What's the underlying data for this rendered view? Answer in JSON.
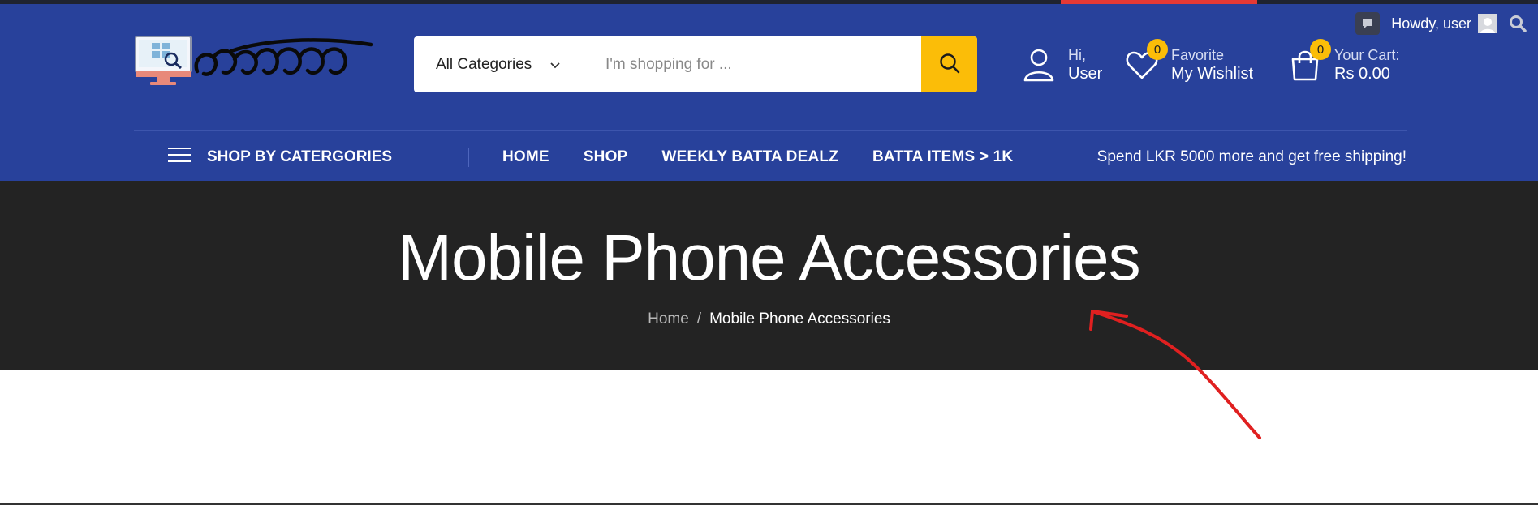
{
  "admin_bar": {
    "greeting": "Howdy, user"
  },
  "logo": {
    "alt": "ලට්ටුබට්ට"
  },
  "search": {
    "category_selected": "All Categories",
    "placeholder": "I'm shopping for ..."
  },
  "account": {
    "line1": "Hi,",
    "line2": "User"
  },
  "wishlist": {
    "count": "0",
    "line1": "Favorite",
    "line2": "My Wishlist"
  },
  "cart": {
    "count": "0",
    "line1": "Your Cart:",
    "line2": "Rs 0.00"
  },
  "nav": {
    "shop_by_categories": "SHOP BY CATERGORIES",
    "items": [
      {
        "label": "HOME"
      },
      {
        "label": "SHOP"
      },
      {
        "label": "WEEKLY BATTA DEALZ"
      },
      {
        "label": "BATTA ITEMS > 1K"
      }
    ],
    "promo": "Spend LKR 5000 more and get free shipping!"
  },
  "hero": {
    "title": "Mobile Phone Accessories",
    "breadcrumb": {
      "home": "Home",
      "separator": "/",
      "current": "Mobile Phone Accessories"
    }
  },
  "colors": {
    "header_bg": "#28419b",
    "accent_yellow": "#fbbd08",
    "hero_bg": "#232323",
    "annotation_red": "#e02020"
  },
  "icons": {
    "admin_comment": "comment-icon",
    "admin_search": "search-icon",
    "search_button": "search-icon",
    "account": "user-icon",
    "wishlist": "heart-icon",
    "cart": "shopping-bag-icon",
    "categories": "hamburger-icon",
    "select_arrow": "chevron-down-icon"
  }
}
